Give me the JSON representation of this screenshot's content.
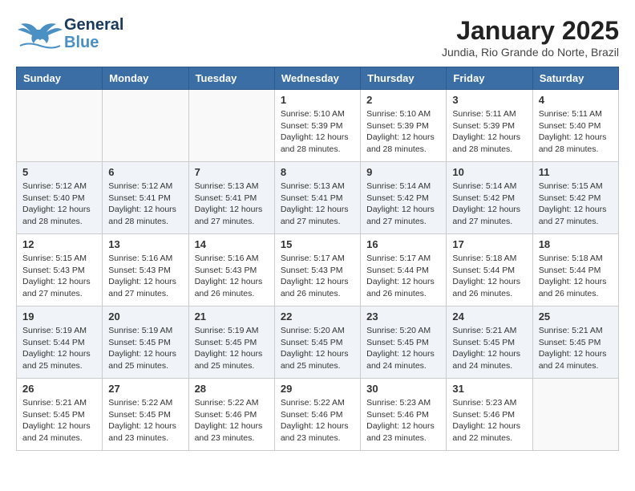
{
  "header": {
    "logo_general": "General",
    "logo_blue": "Blue",
    "month_title": "January 2025",
    "subtitle": "Jundia, Rio Grande do Norte, Brazil"
  },
  "days_of_week": [
    "Sunday",
    "Monday",
    "Tuesday",
    "Wednesday",
    "Thursday",
    "Friday",
    "Saturday"
  ],
  "weeks": [
    [
      {
        "day": "",
        "info": ""
      },
      {
        "day": "",
        "info": ""
      },
      {
        "day": "",
        "info": ""
      },
      {
        "day": "1",
        "info": "Sunrise: 5:10 AM\nSunset: 5:39 PM\nDaylight: 12 hours\nand 28 minutes."
      },
      {
        "day": "2",
        "info": "Sunrise: 5:10 AM\nSunset: 5:39 PM\nDaylight: 12 hours\nand 28 minutes."
      },
      {
        "day": "3",
        "info": "Sunrise: 5:11 AM\nSunset: 5:39 PM\nDaylight: 12 hours\nand 28 minutes."
      },
      {
        "day": "4",
        "info": "Sunrise: 5:11 AM\nSunset: 5:40 PM\nDaylight: 12 hours\nand 28 minutes."
      }
    ],
    [
      {
        "day": "5",
        "info": "Sunrise: 5:12 AM\nSunset: 5:40 PM\nDaylight: 12 hours\nand 28 minutes."
      },
      {
        "day": "6",
        "info": "Sunrise: 5:12 AM\nSunset: 5:41 PM\nDaylight: 12 hours\nand 28 minutes."
      },
      {
        "day": "7",
        "info": "Sunrise: 5:13 AM\nSunset: 5:41 PM\nDaylight: 12 hours\nand 27 minutes."
      },
      {
        "day": "8",
        "info": "Sunrise: 5:13 AM\nSunset: 5:41 PM\nDaylight: 12 hours\nand 27 minutes."
      },
      {
        "day": "9",
        "info": "Sunrise: 5:14 AM\nSunset: 5:42 PM\nDaylight: 12 hours\nand 27 minutes."
      },
      {
        "day": "10",
        "info": "Sunrise: 5:14 AM\nSunset: 5:42 PM\nDaylight: 12 hours\nand 27 minutes."
      },
      {
        "day": "11",
        "info": "Sunrise: 5:15 AM\nSunset: 5:42 PM\nDaylight: 12 hours\nand 27 minutes."
      }
    ],
    [
      {
        "day": "12",
        "info": "Sunrise: 5:15 AM\nSunset: 5:43 PM\nDaylight: 12 hours\nand 27 minutes."
      },
      {
        "day": "13",
        "info": "Sunrise: 5:16 AM\nSunset: 5:43 PM\nDaylight: 12 hours\nand 27 minutes."
      },
      {
        "day": "14",
        "info": "Sunrise: 5:16 AM\nSunset: 5:43 PM\nDaylight: 12 hours\nand 26 minutes."
      },
      {
        "day": "15",
        "info": "Sunrise: 5:17 AM\nSunset: 5:43 PM\nDaylight: 12 hours\nand 26 minutes."
      },
      {
        "day": "16",
        "info": "Sunrise: 5:17 AM\nSunset: 5:44 PM\nDaylight: 12 hours\nand 26 minutes."
      },
      {
        "day": "17",
        "info": "Sunrise: 5:18 AM\nSunset: 5:44 PM\nDaylight: 12 hours\nand 26 minutes."
      },
      {
        "day": "18",
        "info": "Sunrise: 5:18 AM\nSunset: 5:44 PM\nDaylight: 12 hours\nand 26 minutes."
      }
    ],
    [
      {
        "day": "19",
        "info": "Sunrise: 5:19 AM\nSunset: 5:44 PM\nDaylight: 12 hours\nand 25 minutes."
      },
      {
        "day": "20",
        "info": "Sunrise: 5:19 AM\nSunset: 5:45 PM\nDaylight: 12 hours\nand 25 minutes."
      },
      {
        "day": "21",
        "info": "Sunrise: 5:19 AM\nSunset: 5:45 PM\nDaylight: 12 hours\nand 25 minutes."
      },
      {
        "day": "22",
        "info": "Sunrise: 5:20 AM\nSunset: 5:45 PM\nDaylight: 12 hours\nand 25 minutes."
      },
      {
        "day": "23",
        "info": "Sunrise: 5:20 AM\nSunset: 5:45 PM\nDaylight: 12 hours\nand 24 minutes."
      },
      {
        "day": "24",
        "info": "Sunrise: 5:21 AM\nSunset: 5:45 PM\nDaylight: 12 hours\nand 24 minutes."
      },
      {
        "day": "25",
        "info": "Sunrise: 5:21 AM\nSunset: 5:45 PM\nDaylight: 12 hours\nand 24 minutes."
      }
    ],
    [
      {
        "day": "26",
        "info": "Sunrise: 5:21 AM\nSunset: 5:45 PM\nDaylight: 12 hours\nand 24 minutes."
      },
      {
        "day": "27",
        "info": "Sunrise: 5:22 AM\nSunset: 5:45 PM\nDaylight: 12 hours\nand 23 minutes."
      },
      {
        "day": "28",
        "info": "Sunrise: 5:22 AM\nSunset: 5:46 PM\nDaylight: 12 hours\nand 23 minutes."
      },
      {
        "day": "29",
        "info": "Sunrise: 5:22 AM\nSunset: 5:46 PM\nDaylight: 12 hours\nand 23 minutes."
      },
      {
        "day": "30",
        "info": "Sunrise: 5:23 AM\nSunset: 5:46 PM\nDaylight: 12 hours\nand 23 minutes."
      },
      {
        "day": "31",
        "info": "Sunrise: 5:23 AM\nSunset: 5:46 PM\nDaylight: 12 hours\nand 22 minutes."
      },
      {
        "day": "",
        "info": ""
      }
    ]
  ]
}
